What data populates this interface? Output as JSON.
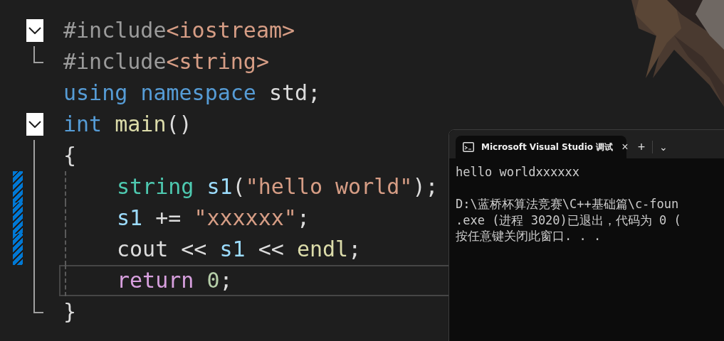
{
  "editor": {
    "lines": [
      {
        "kind": "fold_start",
        "indented": false,
        "changed": false,
        "current": false,
        "tokens": [
          {
            "kind": "preproc",
            "text": "#include"
          },
          {
            "kind": "include",
            "text": "<iostream>"
          }
        ]
      },
      {
        "kind": "fold_end",
        "indented": false,
        "changed": false,
        "current": false,
        "tokens": [
          {
            "kind": "preproc",
            "text": "#include"
          },
          {
            "kind": "include",
            "text": "<string>"
          }
        ]
      },
      {
        "kind": "plain",
        "indented": false,
        "changed": false,
        "current": false,
        "tokens": [
          {
            "kind": "keyword",
            "text": "using "
          },
          {
            "kind": "keyword",
            "text": "namespace "
          },
          {
            "kind": "plain",
            "text": "std"
          },
          {
            "kind": "plain",
            "text": ";"
          }
        ]
      },
      {
        "kind": "fold_start",
        "indented": false,
        "changed": false,
        "current": false,
        "tokens": [
          {
            "kind": "keyword",
            "text": "int "
          },
          {
            "kind": "function",
            "text": "main"
          },
          {
            "kind": "plain",
            "text": "()"
          }
        ]
      },
      {
        "kind": "folded_body",
        "indented": false,
        "changed": false,
        "current": false,
        "tokens": [
          {
            "kind": "plain",
            "text": "{"
          }
        ]
      },
      {
        "kind": "folded_body",
        "indented": true,
        "changed": true,
        "current": false,
        "tokens": [
          {
            "kind": "type",
            "text": "string "
          },
          {
            "kind": "variable",
            "text": "s1"
          },
          {
            "kind": "plain",
            "text": "("
          },
          {
            "kind": "string",
            "text": "\"hello world\""
          },
          {
            "kind": "plain",
            "text": ");"
          }
        ]
      },
      {
        "kind": "folded_body",
        "indented": true,
        "changed": true,
        "current": false,
        "tokens": [
          {
            "kind": "variable",
            "text": "s1"
          },
          {
            "kind": "plain",
            "text": " += "
          },
          {
            "kind": "string",
            "text": "\"xxxxxx\""
          },
          {
            "kind": "plain",
            "text": ";"
          }
        ]
      },
      {
        "kind": "folded_body",
        "indented": true,
        "changed": true,
        "current": false,
        "tokens": [
          {
            "kind": "plain",
            "text": "cout << "
          },
          {
            "kind": "variable",
            "text": "s1"
          },
          {
            "kind": "plain",
            "text": " << "
          },
          {
            "kind": "function",
            "text": "endl"
          },
          {
            "kind": "plain",
            "text": ";"
          }
        ]
      },
      {
        "kind": "folded_body",
        "indented": true,
        "changed": false,
        "current": true,
        "tokens": [
          {
            "kind": "control",
            "text": "return "
          },
          {
            "kind": "number",
            "text": "0"
          },
          {
            "kind": "plain",
            "text": ";"
          }
        ]
      },
      {
        "kind": "fold_end",
        "indented": false,
        "changed": false,
        "current": false,
        "tokens": [
          {
            "kind": "plain",
            "text": "}"
          }
        ]
      }
    ]
  },
  "console": {
    "tab": {
      "title": "Microsoft Visual Studio 调试",
      "close": "×",
      "selected": true
    },
    "new_tab": "+",
    "dropdown": "⌄",
    "output": [
      [
        "hello worldxxxxxx"
      ],
      [
        "D:\\蓝桥杯算法竞赛\\C++基础篇\\c-foun",
        ".exe (进程 3020)已退出，代码为 0 (",
        "按任意键关闭此窗口. . ."
      ]
    ]
  }
}
